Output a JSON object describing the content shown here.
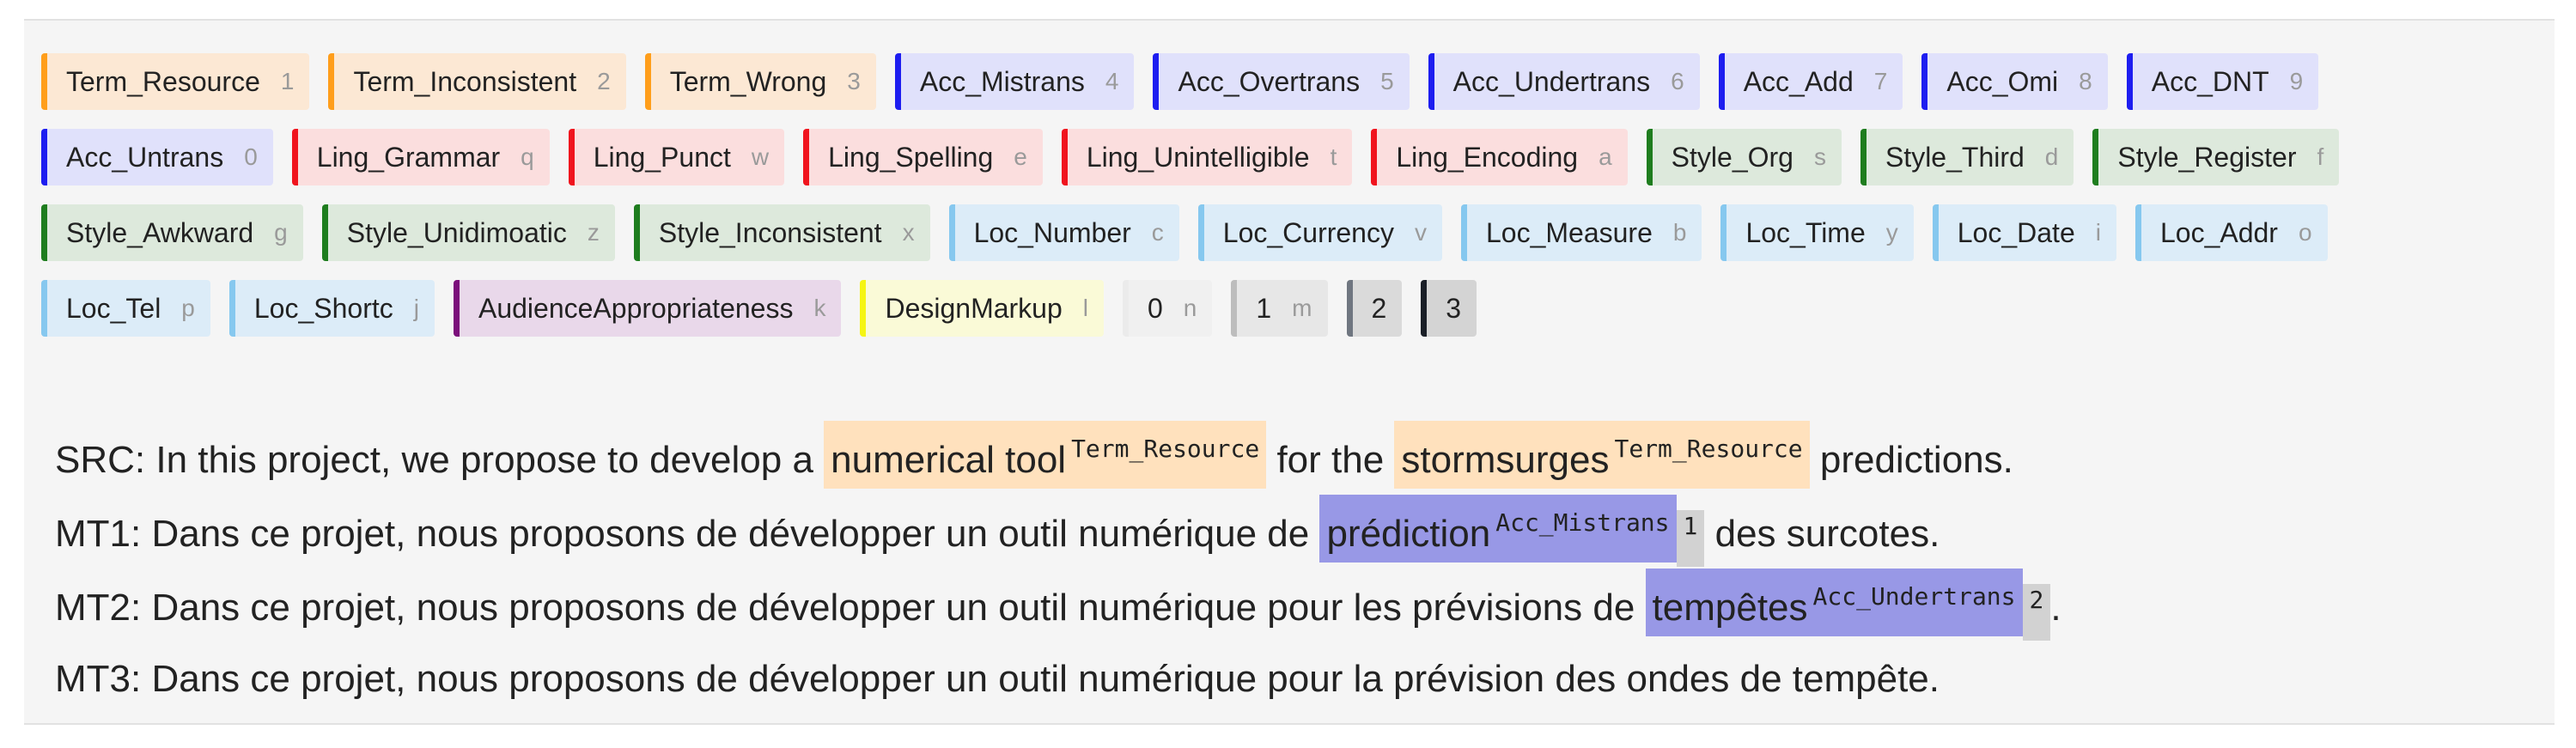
{
  "labels": [
    {
      "name": "Term_Resource",
      "key": "1",
      "bg": "#fce8d4",
      "border": "#ff9e1b"
    },
    {
      "name": "Term_Inconsistent",
      "key": "2",
      "bg": "#fce8d4",
      "border": "#ff9e1b"
    },
    {
      "name": "Term_Wrong",
      "key": "3",
      "bg": "#fce8d4",
      "border": "#ff9e1b"
    },
    {
      "name": "Acc_Mistrans",
      "key": "4",
      "bg": "#e0e1fb",
      "border": "#1d1df0"
    },
    {
      "name": "Acc_Overtrans",
      "key": "5",
      "bg": "#e0e1fb",
      "border": "#1d1df0"
    },
    {
      "name": "Acc_Undertrans",
      "key": "6",
      "bg": "#e0e1fb",
      "border": "#1d1df0"
    },
    {
      "name": "Acc_Add",
      "key": "7",
      "bg": "#e0e1fb",
      "border": "#1d1df0"
    },
    {
      "name": "Acc_Omi",
      "key": "8",
      "bg": "#e0e1fb",
      "border": "#1d1df0"
    },
    {
      "name": "Acc_DNT",
      "key": "9",
      "bg": "#e0e1fb",
      "border": "#1d1df0"
    },
    {
      "name": "Acc_Untrans",
      "key": "0",
      "bg": "#e0e1fb",
      "border": "#1d1df0"
    },
    {
      "name": "Ling_Grammar",
      "key": "q",
      "bg": "#fbdede",
      "border": "#f0141e"
    },
    {
      "name": "Ling_Punct",
      "key": "w",
      "bg": "#fbdede",
      "border": "#f0141e"
    },
    {
      "name": "Ling_Spelling",
      "key": "e",
      "bg": "#fbdede",
      "border": "#f0141e"
    },
    {
      "name": "Ling_Unintelligible",
      "key": "t",
      "bg": "#fbdede",
      "border": "#f0141e"
    },
    {
      "name": "Ling_Encoding",
      "key": "a",
      "bg": "#fbdede",
      "border": "#f0141e"
    },
    {
      "name": "Style_Org",
      "key": "s",
      "bg": "#dde9dc",
      "border": "#1e7d1e"
    },
    {
      "name": "Style_Third",
      "key": "d",
      "bg": "#dde9dc",
      "border": "#1e7d1e"
    },
    {
      "name": "Style_Register",
      "key": "f",
      "bg": "#dde9dc",
      "border": "#1e7d1e"
    },
    {
      "name": "Style_Awkward",
      "key": "g",
      "bg": "#dde9dc",
      "border": "#1e7d1e"
    },
    {
      "name": "Style_Unidimoatic",
      "key": "z",
      "bg": "#dde9dc",
      "border": "#1e7d1e"
    },
    {
      "name": "Style_Inconsistent",
      "key": "x",
      "bg": "#dde9dc",
      "border": "#1e7d1e"
    },
    {
      "name": "Loc_Number",
      "key": "c",
      "bg": "#dcecf8",
      "border": "#86c8ef"
    },
    {
      "name": "Loc_Currency",
      "key": "v",
      "bg": "#dcecf8",
      "border": "#86c8ef"
    },
    {
      "name": "Loc_Measure",
      "key": "b",
      "bg": "#dcecf8",
      "border": "#86c8ef"
    },
    {
      "name": "Loc_Time",
      "key": "y",
      "bg": "#dcecf8",
      "border": "#86c8ef"
    },
    {
      "name": "Loc_Date",
      "key": "i",
      "bg": "#dcecf8",
      "border": "#86c8ef"
    },
    {
      "name": "Loc_Addr",
      "key": "o",
      "bg": "#dcecf8",
      "border": "#86c8ef"
    },
    {
      "name": "Loc_Tel",
      "key": "p",
      "bg": "#dcecf8",
      "border": "#86c8ef"
    },
    {
      "name": "Loc_Shortc",
      "key": "j",
      "bg": "#dcecf8",
      "border": "#86c8ef"
    },
    {
      "name": "AudienceAppropriateness",
      "key": "k",
      "bg": "#e9d8ea",
      "border": "#7b0e7b"
    },
    {
      "name": "DesignMarkup",
      "key": "l",
      "bg": "#fafad7",
      "border": "#f5f513"
    },
    {
      "name": "0",
      "key": "n",
      "bg": "#f0f0f0",
      "border": "#ebebeb"
    },
    {
      "name": "1",
      "key": "m",
      "bg": "#e7e7e7",
      "border": "#bdbdbd"
    },
    {
      "name": "2",
      "key": "",
      "bg": "#dadada",
      "border": "#6f7680"
    },
    {
      "name": "3",
      "key": "",
      "bg": "#d4d4d4",
      "border": "#1a1f27"
    }
  ],
  "sentences": {
    "src": {
      "prefix": "SRC: In this project, we propose to develop a ",
      "span1": "numerical tool",
      "tag1": "Term_Resource",
      "middle": " for the ",
      "span2": "stormsurges",
      "tag2": "Term_Resource",
      "suffix": " predictions.",
      "color": "#ffe1bd"
    },
    "mt1": {
      "prefix": "MT1: Dans ce projet, nous proposons de développer un outil numérique de ",
      "span": "prédiction",
      "tag": "Acc_Mistrans",
      "severity": "1",
      "suffix": " des surcotes.",
      "color": "#9898e6"
    },
    "mt2": {
      "prefix": "MT2: Dans ce projet, nous proposons de développer un outil numérique pour les prévisions de ",
      "span": "tempêtes",
      "tag": "Acc_Undertrans",
      "severity": "2",
      "suffix": ".",
      "color": "#9898e6"
    },
    "mt3": {
      "text": "MT3: Dans ce projet, nous proposons de développer un outil numérique pour la prévision des ondes de tempête."
    }
  }
}
